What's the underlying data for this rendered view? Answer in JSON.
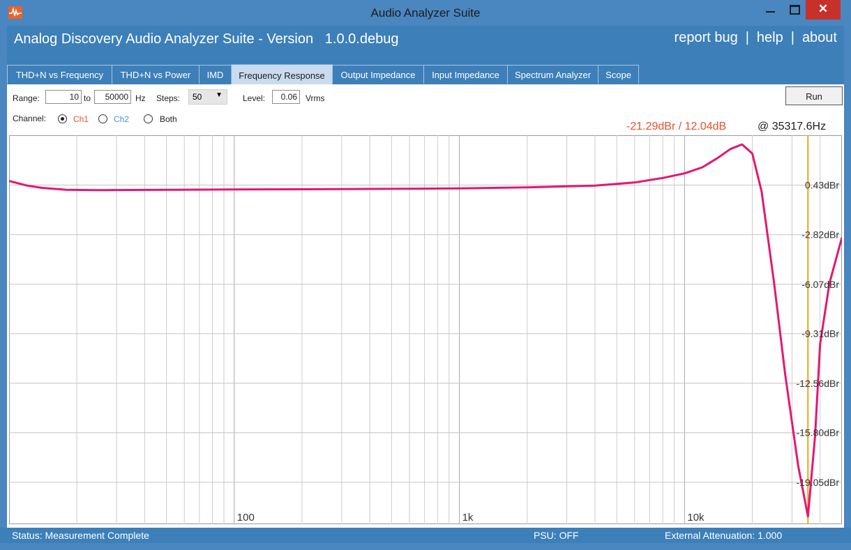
{
  "window": {
    "title": "Audio Analyzer Suite",
    "close_glyph": "✕"
  },
  "header": {
    "title": "Analog Discovery Audio Analyzer Suite - Version   1.0.0.debug",
    "links": [
      "report bug",
      "help",
      "about"
    ],
    "separator": "|"
  },
  "tabs": [
    {
      "label": "THD+N vs Frequency"
    },
    {
      "label": "THD+N vs Power"
    },
    {
      "label": "IMD"
    },
    {
      "label": "Frequency Response"
    },
    {
      "label": "Output Impedance"
    },
    {
      "label": "Input Impedance"
    },
    {
      "label": "Spectrum Analyzer"
    },
    {
      "label": "Scope"
    }
  ],
  "active_tab": "Frequency Response",
  "controls": {
    "range_label": "Range:",
    "range_from": "10",
    "range_to_label": "to",
    "range_to": "50000",
    "range_unit": "Hz",
    "steps_label": "Steps:",
    "steps_value": "50",
    "level_label": "Level:",
    "level_value": "0.06",
    "level_unit": "Vrms",
    "run_label": "Run",
    "channel_label": "Channel:",
    "ch1_label": "Ch1",
    "ch2_label": "Ch2",
    "both_label": "Both",
    "selected_channel": "Ch1",
    "ch1_color": "#e8502a",
    "ch2_color": "#4a8fd6"
  },
  "readout": {
    "value": "-21.29dBr / 12.04dB",
    "freq": "@ 35317.6Hz",
    "value_color": "#e8502a"
  },
  "chart_data": {
    "type": "line",
    "x_scale": "log",
    "xlim": [
      10,
      50000
    ],
    "ylim": [
      -21.8,
      3.7
    ],
    "x_tick_labels": [
      {
        "x": 100,
        "label": "100"
      },
      {
        "x": 1000,
        "label": "1k"
      },
      {
        "x": 10000,
        "label": "10k"
      }
    ],
    "y_tick_labels": [
      {
        "y": 0.43,
        "label": "0.43dBr"
      },
      {
        "y": -2.82,
        "label": "-2.82dBr"
      },
      {
        "y": -6.07,
        "label": "-6.07dBr"
      },
      {
        "y": -9.31,
        "label": "-9.31dBr"
      },
      {
        "y": -12.56,
        "label": "-12.56dBr"
      },
      {
        "y": -15.8,
        "label": "-15.80dBr"
      },
      {
        "y": -19.05,
        "label": "-19.05dBr"
      }
    ],
    "cursor_x": 35317.6,
    "grid": true,
    "series": [
      {
        "color": "#e5176f",
        "points": [
          [
            10,
            0.7
          ],
          [
            12,
            0.4
          ],
          [
            14,
            0.25
          ],
          [
            18,
            0.12
          ],
          [
            25,
            0.1
          ],
          [
            50,
            0.12
          ],
          [
            100,
            0.15
          ],
          [
            200,
            0.16
          ],
          [
            400,
            0.18
          ],
          [
            700,
            0.2
          ],
          [
            1000,
            0.22
          ],
          [
            2000,
            0.28
          ],
          [
            4000,
            0.4
          ],
          [
            6000,
            0.6
          ],
          [
            8000,
            0.9
          ],
          [
            10000,
            1.2
          ],
          [
            12000,
            1.6
          ],
          [
            14000,
            2.2
          ],
          [
            16000,
            2.8
          ],
          [
            18000,
            3.1
          ],
          [
            20000,
            2.5
          ],
          [
            22000,
            0.0
          ],
          [
            25000,
            -6.0
          ],
          [
            28000,
            -12.0
          ],
          [
            32000,
            -18.0
          ],
          [
            35317.6,
            -21.29
          ],
          [
            38000,
            -16.0
          ],
          [
            40000,
            -10.0
          ],
          [
            44000,
            -6.0
          ],
          [
            50000,
            -3.0
          ]
        ]
      }
    ],
    "cursor_color": "#f2a318"
  },
  "status": {
    "text": "Status: Measurement Complete",
    "psu": "PSU: OFF",
    "attenuation": "External Attenuation: 1.000"
  }
}
